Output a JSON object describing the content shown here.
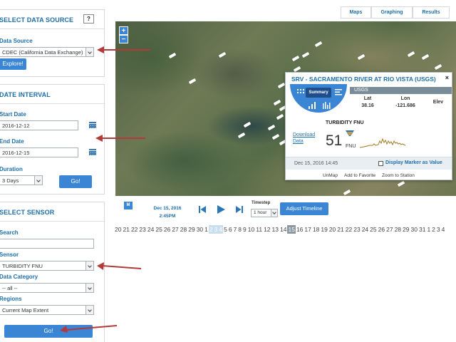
{
  "data_source": {
    "title": "SELECT DATA SOURCE",
    "help": "?",
    "label": "Data Source",
    "selected": "CDEC (California Data Exchange)",
    "explore_button": "Explore!"
  },
  "date_interval": {
    "title": "DATE INTERVAL",
    "start_label": "Start Date",
    "start_value": "2016-12-12",
    "end_label": "End Date",
    "end_value": "2016-12-15",
    "duration_label": "Duration",
    "duration_value": "3 Days",
    "go_button": "Go!"
  },
  "sensor": {
    "title": "SELECT SENSOR",
    "search_label": "Search",
    "search_value": "",
    "sensor_label": "Sensor",
    "sensor_value": "TURBIDITY FNU",
    "category_label": "Data Category",
    "category_value": "-- all --",
    "regions_label": "Regions",
    "regions_value": "Current Map Extent",
    "go_button": "Go!"
  },
  "tabs": [
    {
      "label": "Maps"
    },
    {
      "label": "Graphing"
    },
    {
      "label": "Results"
    }
  ],
  "map": {
    "zoom_in": "+",
    "zoom_out": "−"
  },
  "popup": {
    "title": "SRV - SACRAMENTO RIVER AT RIO VISTA (USGS)",
    "close": "×",
    "summary_tab": "Summary",
    "agency": "USGS",
    "lat_label": "Lat",
    "lat_value": "38.16",
    "lon_label": "Lon",
    "lon_value": "-121.686",
    "elev_label": "Elev",
    "download_link": "Download Data",
    "parameter": "TURBIDITY FNU",
    "value": "51",
    "unit": "FNU",
    "timestamp": "Dec 15, 2016 14:45",
    "display_marker": "Display Marker as Value",
    "actions": [
      "UnMap",
      "Add to Favorite",
      "Zoom to Station"
    ]
  },
  "timeline": {
    "map_icon": "M",
    "date": "Dec 15, 2016",
    "time": "2:45PM",
    "timestep_label": "Timestep",
    "timestep_value": "1 hour",
    "adjust_button": "Adjust Timeline",
    "days": [
      "20",
      "21",
      "22",
      "23",
      "24",
      "25",
      "26",
      "27",
      "28",
      "29",
      "30",
      "1",
      "2",
      "3",
      "4",
      "5",
      "6",
      "7",
      "8",
      "9",
      "10",
      "11",
      "12",
      "13",
      "14",
      "15",
      "16",
      "17",
      "18",
      "19",
      "20",
      "21",
      "22",
      "23",
      "24",
      "25",
      "26",
      "27",
      "28",
      "29",
      "30",
      "31",
      "1",
      "2",
      "3",
      "4"
    ],
    "selected_days": [
      12,
      13,
      14
    ],
    "current_day_index": 25
  },
  "colors": {
    "accent": "#1f6fa8",
    "button": "#3a85d4",
    "annotation_arrow": "#b23a3a"
  }
}
